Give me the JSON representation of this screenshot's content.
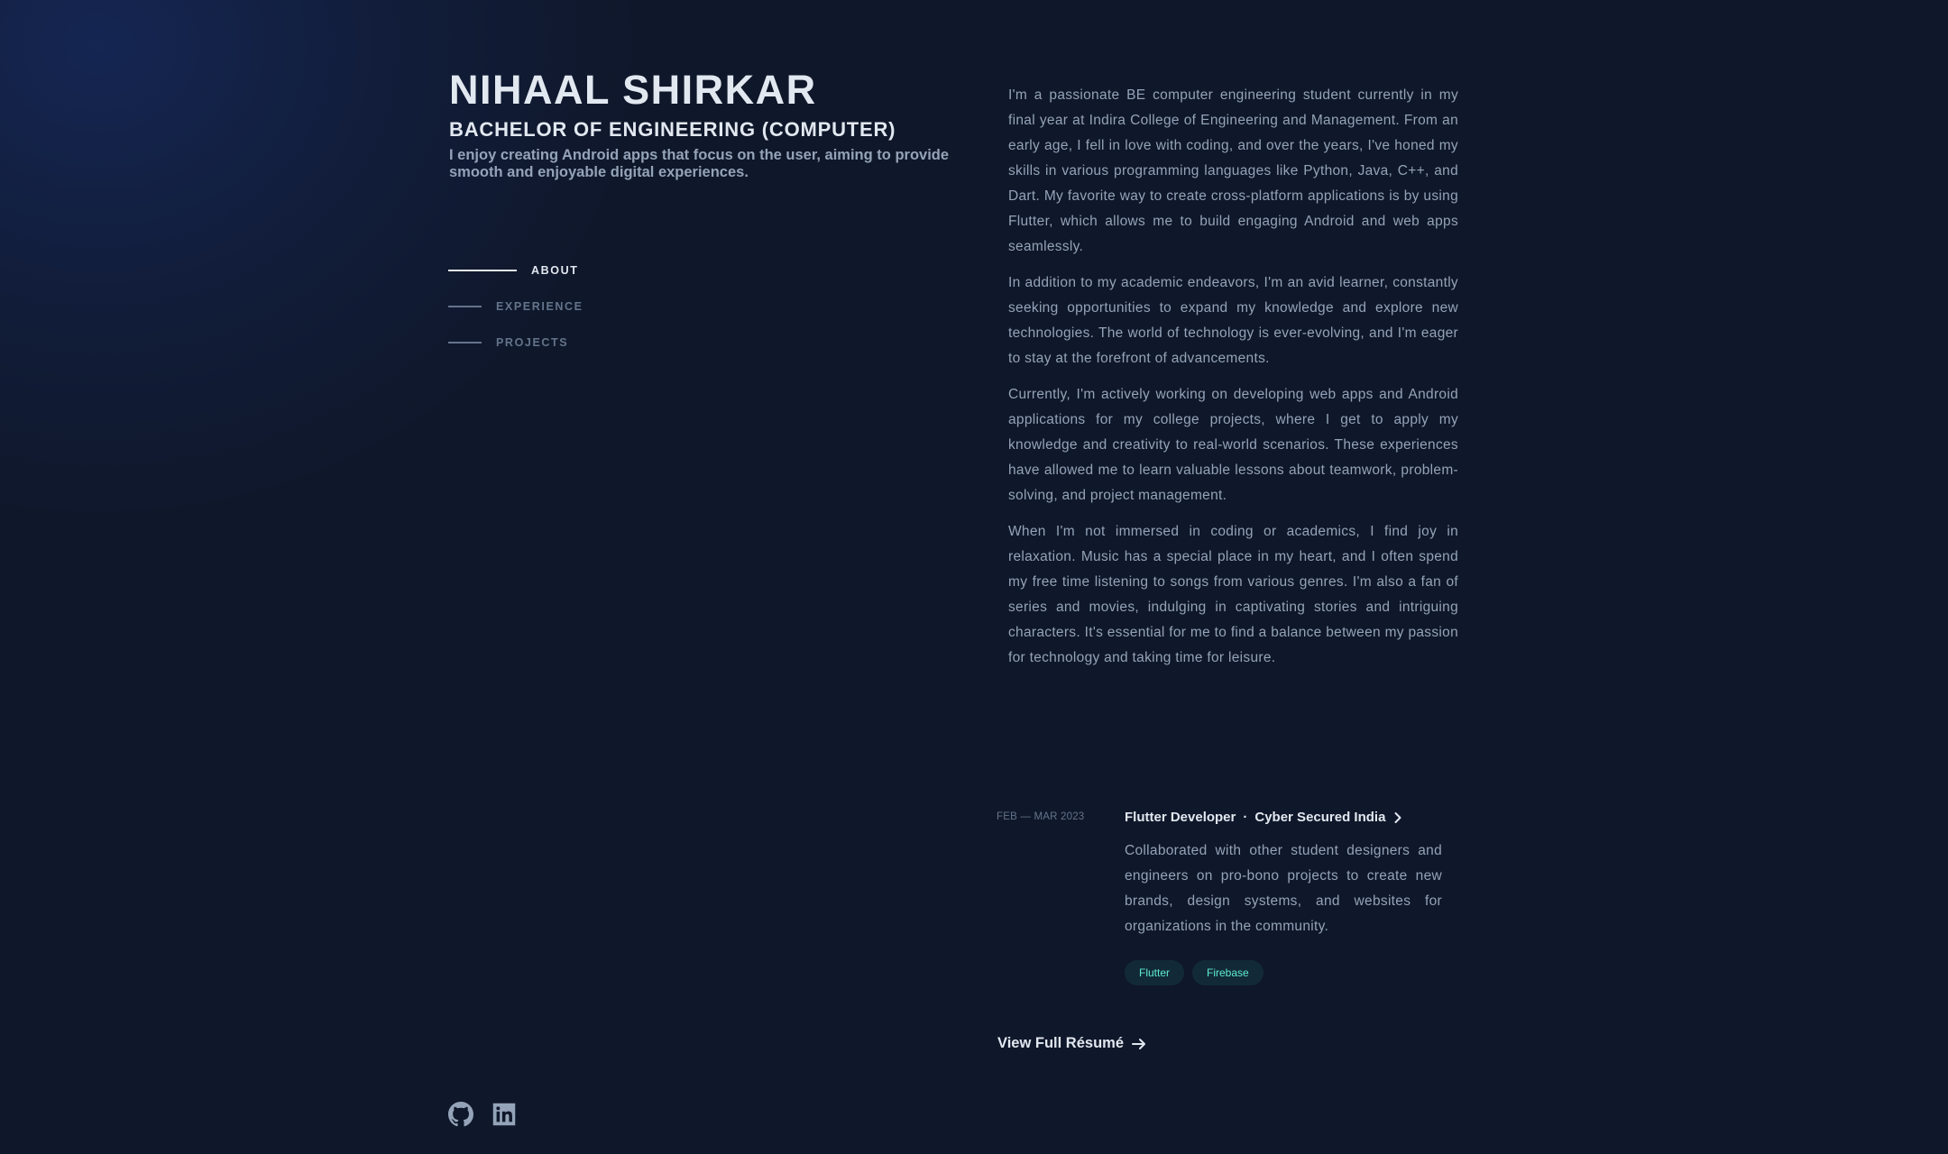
{
  "header": {
    "name": "NIHAAL SHIRKAR",
    "degree": "BACHELOR OF ENGINEERING (COMPUTER)",
    "tagline": "I enjoy creating Android apps that focus on the user, aiming to provide smooth and enjoyable digital experiences."
  },
  "nav": {
    "items": [
      {
        "label": "ABOUT",
        "active": true
      },
      {
        "label": "EXPERIENCE",
        "active": false
      },
      {
        "label": "PROJECTS",
        "active": false
      }
    ]
  },
  "about": {
    "paragraphs": [
      "I'm a passionate BE computer engineering student currently in my final year at Indira College of Engineering and Management. From an early age, I fell in love with coding, and over the years, I've honed my skills in various programming languages like Python, Java, C++, and Dart. My favorite way to create cross-platform applications is by using Flutter, which allows me to build engaging Android and web apps seamlessly.",
      "In addition to my academic endeavors, I'm an avid learner, constantly seeking opportunities to expand my knowledge and explore new technologies. The world of technology is ever-evolving, and I'm eager to stay at the forefront of advancements.",
      "Currently, I'm actively working on developing web apps and Android applications for my college projects, where I get to apply my knowledge and creativity to real-world scenarios. These experiences have allowed me to learn valuable lessons about teamwork, problem-solving, and project management.",
      "When I'm not immersed in coding or academics, I find joy in relaxation. Music has a special place in my heart, and I often spend my free time listening to songs from various genres. I'm also a fan of series and movies, indulging in captivating stories and intriguing characters. It's essential for me to find a balance between my passion for technology and taking time for leisure."
    ]
  },
  "experience": {
    "jobs": [
      {
        "date": "FEB — MAR 2023",
        "role": "Flutter Developer",
        "separator": "·",
        "company": "Cyber Secured India",
        "description": "Collaborated with other student designers and engineers on pro-bono projects to create new brands, design systems, and websites for organizations in the community.",
        "tags": [
          "Flutter",
          "Firebase"
        ]
      }
    ],
    "resume_link": "View Full Résumé"
  },
  "socials": {
    "icons": [
      "github-icon",
      "linkedin-icon"
    ]
  },
  "colors": {
    "background": "#0f172a",
    "heading": "#e2e8f0",
    "body_text": "#94a3b8",
    "muted": "#64748b",
    "tag_text": "#5eead4",
    "glow": "#1d3a8a"
  }
}
